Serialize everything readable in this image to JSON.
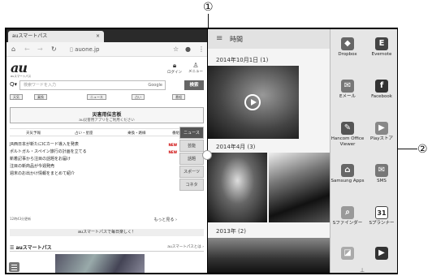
{
  "callouts": {
    "one": "①",
    "two": "②"
  },
  "browser": {
    "tab_title": "auスマートパス",
    "tab_close": "×",
    "url": "auone.jp",
    "logo": "au",
    "logo_sub": "auスマートパス",
    "login": "ログイン",
    "menu": "メニュー",
    "search_placeholder": "検索ワードを入力",
    "search_engine": "Google",
    "search_button": "検索",
    "gnav": [
      "天気",
      "乗換",
      "ニュース",
      "占い",
      "番組"
    ],
    "board_title": "災害用伝言板",
    "board_sub": "au災害用アプリをご利用ください",
    "services": [
      "天気予報",
      "占い・星座",
      "乗換・路線",
      "番組表"
    ],
    "news": [
      {
        "text": "JR西日本が新たにICカード導入を発表",
        "badge": "NEW"
      },
      {
        "text": "ポルトガル・スペイン旅行の計画を立てる",
        "badge": "NEW"
      },
      {
        "text": "新着記事から注目の話題をお届け",
        "badge": ""
      },
      {
        "text": "注目の新商品が今週発売",
        "badge": ""
      },
      {
        "text": "週末のお出かけ情報をまとめて紹介",
        "badge": ""
      }
    ],
    "side_tabs": [
      "ニュース",
      "芸能",
      "話題",
      "スポーツ",
      "コネタ"
    ],
    "news_date": "12時43分更新",
    "more": "もっと見る",
    "banner": "auスマートパスで毎日楽しく！",
    "smartpass_title": "auスマートパス",
    "smartpass_link": "auスマートパスとは"
  },
  "gallery": {
    "title": "時間",
    "groups": [
      "2014年10月1日 (1)",
      "2014年4月 (3)",
      "2013年 (2)"
    ]
  },
  "apps": [
    {
      "label": "Dropbox",
      "icon": "dropbox-icon",
      "color": "#666"
    },
    {
      "label": "Evernote",
      "icon": "evernote-icon",
      "color": "#444"
    },
    {
      "label": "Eメール",
      "icon": "email-icon",
      "color": "#777"
    },
    {
      "label": "Facebook",
      "icon": "facebook-icon",
      "color": "#333"
    },
    {
      "label": "Hancom Office Viewer",
      "icon": "hancom-icon",
      "color": "#555"
    },
    {
      "label": "Playストア",
      "icon": "playstore-icon",
      "color": "#888"
    },
    {
      "label": "Samsung Apps",
      "icon": "samsung-apps-icon",
      "color": "#666"
    },
    {
      "label": "SMS",
      "icon": "sms-icon",
      "color": "#777"
    },
    {
      "label": "Sファインダー",
      "icon": "sfinder-icon",
      "color": "#999"
    },
    {
      "label": "Sプランナー",
      "icon": "splanner-icon",
      "color": "#444"
    },
    {
      "label": "",
      "icon": "app-icon",
      "color": "#aaa"
    },
    {
      "label": "",
      "icon": "play-icon",
      "color": "#333"
    }
  ],
  "calendar_day": "31"
}
